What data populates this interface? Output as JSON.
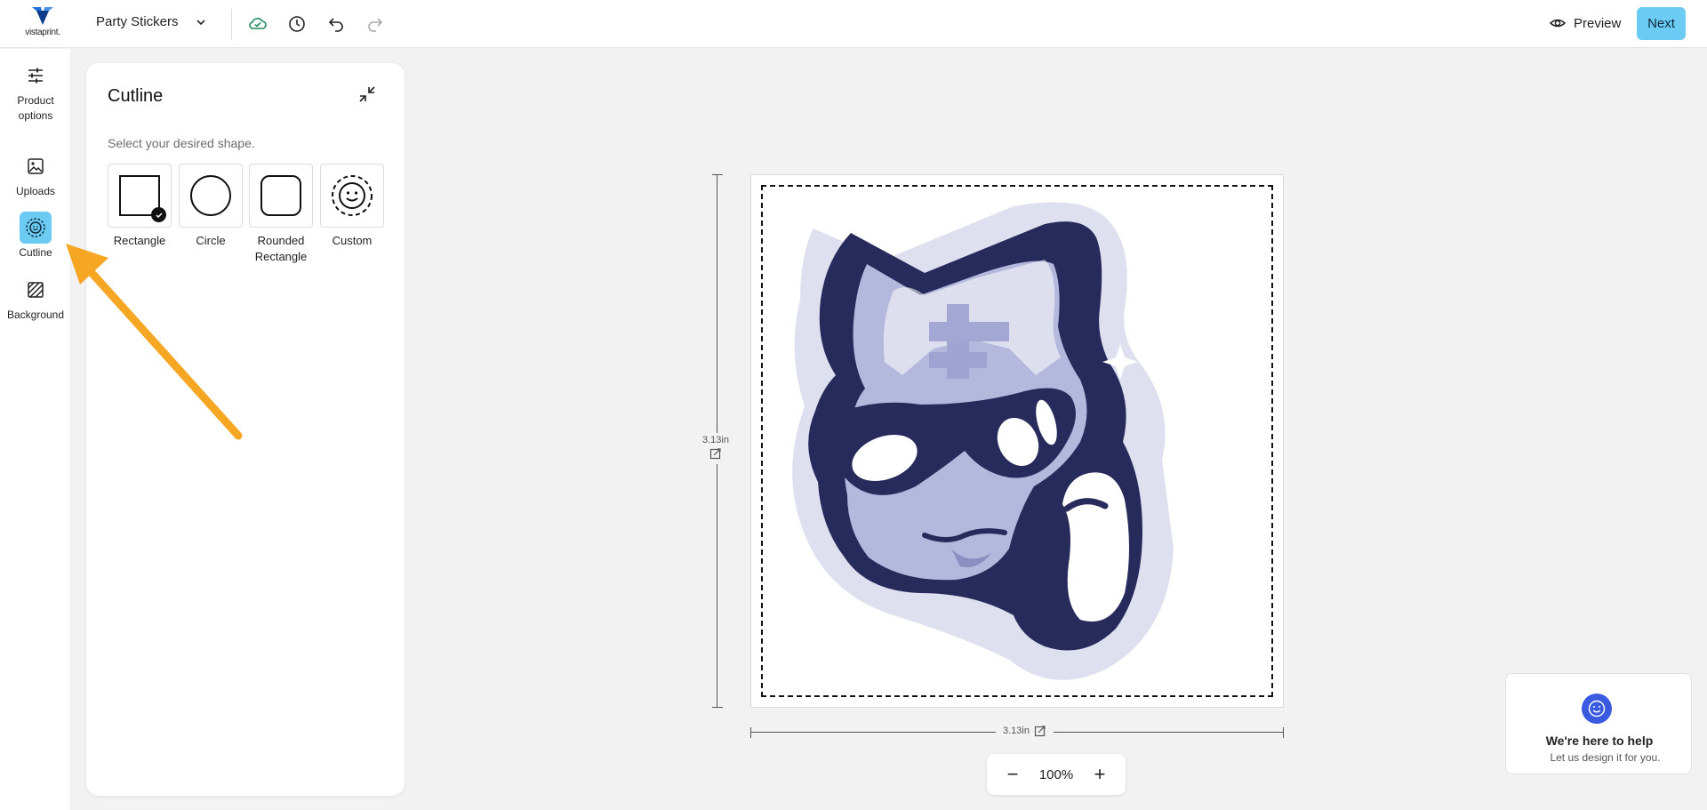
{
  "header": {
    "logo_text": "vistaprint.",
    "document_name": "Party Stickers",
    "preview_label": "Preview",
    "next_label": "Next",
    "icons": [
      "cloud-saved-icon",
      "history-icon",
      "undo-icon",
      "redo-icon"
    ]
  },
  "rail": {
    "items": [
      {
        "label_line1": "Product",
        "label_line2": "options",
        "icon": "sliders-icon"
      },
      {
        "label": "Uploads",
        "icon": "image-icon"
      },
      {
        "label": "Cutline",
        "icon": "cutline-icon",
        "active": true
      },
      {
        "label": "Background",
        "icon": "hatch-icon"
      }
    ]
  },
  "panel": {
    "title": "Cutline",
    "subtitle": "Select your desired shape.",
    "shapes": [
      {
        "label": "Rectangle",
        "selected": true
      },
      {
        "label": "Circle"
      },
      {
        "label_line1": "Rounded",
        "label_line2": "Rectangle"
      },
      {
        "label": "Custom"
      }
    ]
  },
  "canvas": {
    "height_label": "3.13in",
    "width_label": "3.13in",
    "zoom": "100%",
    "zoom_out": "−",
    "zoom_in": "+"
  },
  "help": {
    "title": "We're here to help",
    "subtitle": "Let us design it for you."
  },
  "colors": {
    "accent": "#6ccbf3",
    "sticker_navy": "#262b5c",
    "sticker_lavender": "#b4b8dc",
    "sticker_halo": "#dfe0ef",
    "annotation_arrow": "#f5a623",
    "help_blue": "#3a5ae0"
  }
}
